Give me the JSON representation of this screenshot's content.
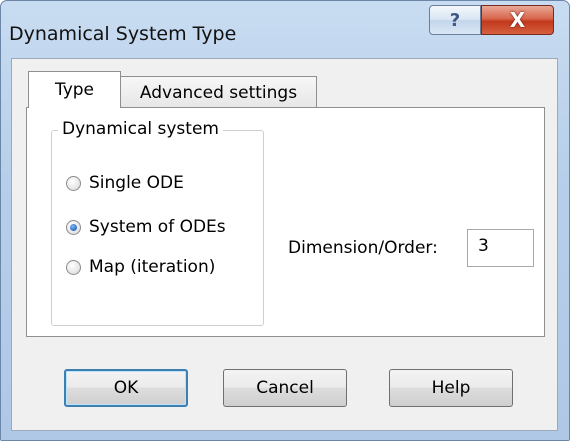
{
  "window": {
    "title": "Dynamical System Type",
    "help_glyph": "?",
    "close_glyph": "X"
  },
  "tabs": [
    {
      "label": "Type",
      "selected": true
    },
    {
      "label": "Advanced settings",
      "selected": false
    }
  ],
  "group": {
    "title": "Dynamical system",
    "options": [
      {
        "label": "Single ODE",
        "checked": false
      },
      {
        "label": "System of ODEs",
        "checked": true
      },
      {
        "label": "Map (iteration)",
        "checked": false
      }
    ]
  },
  "dimension": {
    "label": "Dimension/Order:",
    "value": "3"
  },
  "buttons": {
    "ok": "OK",
    "cancel": "Cancel",
    "help": "Help"
  }
}
